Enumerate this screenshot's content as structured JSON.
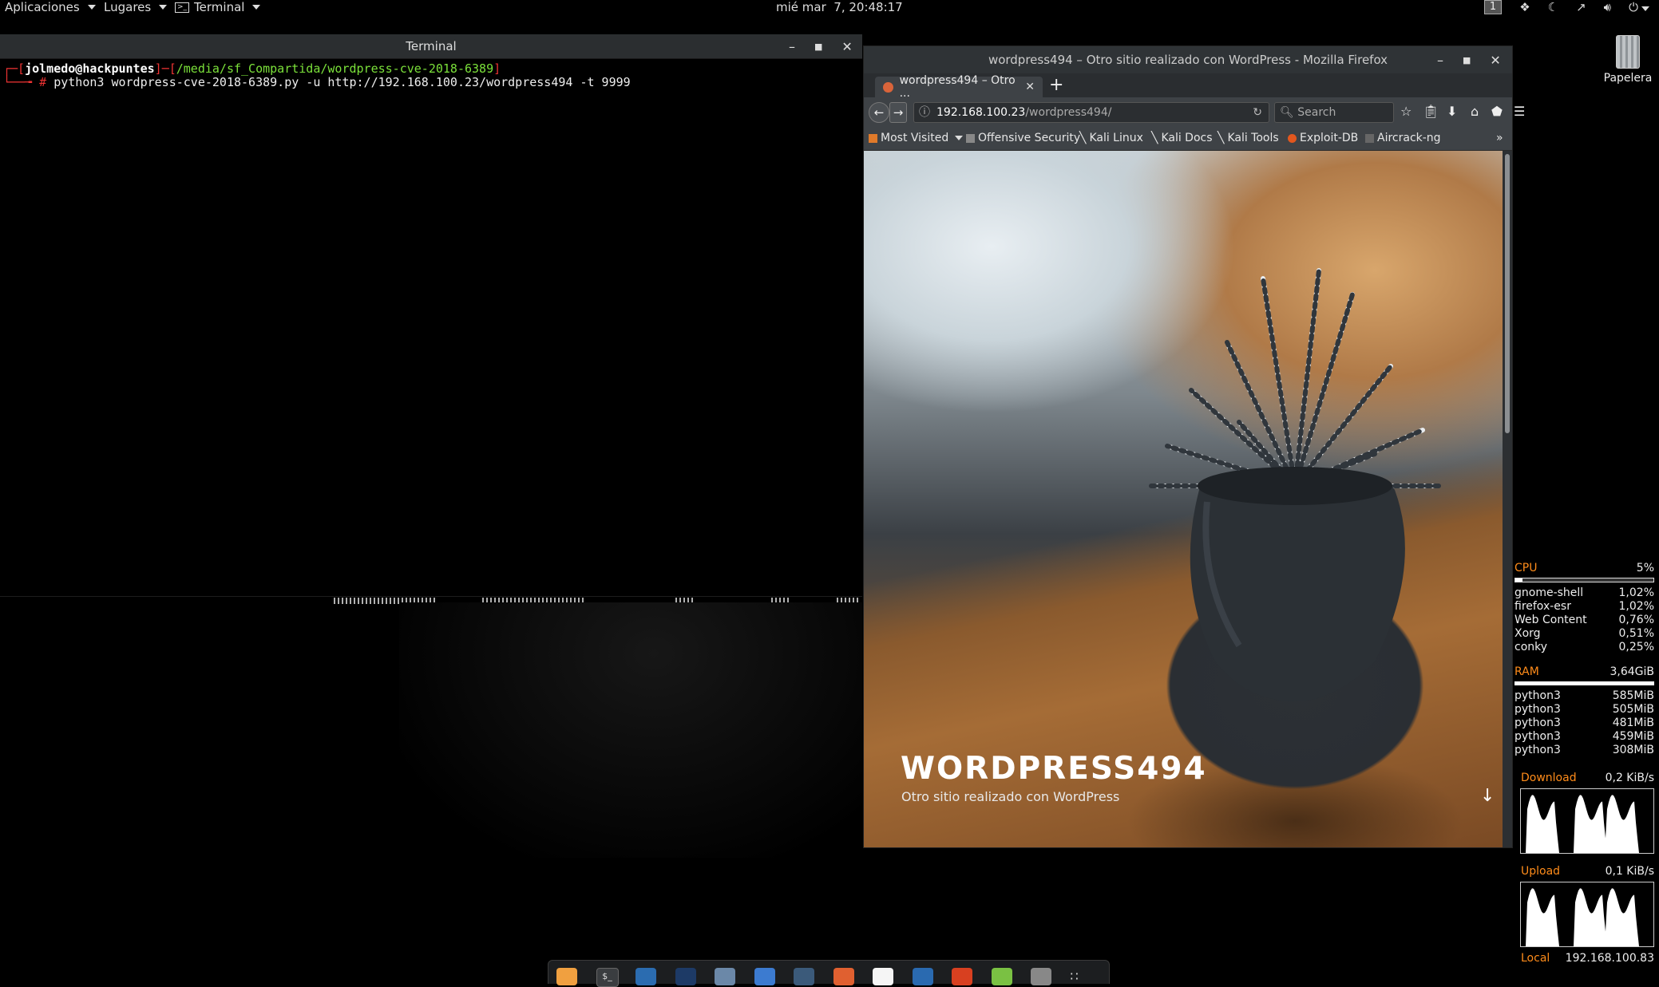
{
  "topbar": {
    "applications": "Aplicaciones",
    "places": "Lugares",
    "terminal_menu": "Terminal",
    "clock": "mié mar  7, 20:48:17",
    "workspace": "1"
  },
  "terminal": {
    "title": "Terminal",
    "prompt_open": "┌─[",
    "user_host": "jolmedo@hackpuntes",
    "prompt_mid": "]─[",
    "path": "/media/sf_Compartida/wordpress-cve-2018-6389",
    "prompt_close": "]",
    "prompt_line2": "└──╼ ",
    "hash": "#",
    "command": " python3 wordpress-cve-2018-6389.py -u http://192.168.100.23/wordpress494 -t 9999"
  },
  "firefox": {
    "window_title": "wordpress494 – Otro sitio realizado con WordPress - Mozilla Firefox",
    "tab_label": "wordpress494 – Otro ...",
    "url_host": "192.168.100.23",
    "url_path": "/wordpress494/",
    "search_placeholder": "Search",
    "bookmarks": [
      "Most Visited",
      "Offensive Security",
      "Kali Linux",
      "Kali Docs",
      "Kali Tools",
      "Exploit-DB",
      "Aircrack-ng"
    ],
    "page": {
      "site_title": "WORDPRESS494",
      "site_description": "Otro sitio realizado con WordPress"
    }
  },
  "desktop": {
    "trash_label": "Papelera"
  },
  "conky": {
    "cpu_label": "CPU",
    "cpu_value": "5%",
    "cpu_fraction": 0.05,
    "cpu_procs": [
      {
        "name": "gnome-shell",
        "value": "1,02%"
      },
      {
        "name": "firefox-esr",
        "value": "1,02%"
      },
      {
        "name": "Web Content",
        "value": "0,76%"
      },
      {
        "name": "Xorg",
        "value": "0,51%"
      },
      {
        "name": "conky",
        "value": "0,25%"
      }
    ],
    "ram_label": "RAM",
    "ram_value": "3,64GiB",
    "ram_procs": [
      {
        "name": "python3",
        "value": "585MiB"
      },
      {
        "name": "python3",
        "value": "505MiB"
      },
      {
        "name": "python3",
        "value": "481MiB"
      },
      {
        "name": "python3",
        "value": "459MiB"
      },
      {
        "name": "python3",
        "value": "308MiB"
      }
    ],
    "download_label": "Download",
    "download_value": "0,2 KiB/s",
    "upload_label": "Upload",
    "upload_value": "0,1 KiB/s",
    "local_label": "Local",
    "local_value": "192.168.100.83"
  },
  "colors": {
    "prompt_red": "#ee3333",
    "path_green": "#7be13a",
    "conky_orange": "#ff8c1a",
    "panel_bg": "#000000"
  },
  "dock_icons": [
    "vm-icon",
    "terminal-icon",
    "kali-icon",
    "browser-icon",
    "files-icon",
    "metasploit-icon",
    "armitage-icon",
    "burp-icon",
    "maltego-icon",
    "beef-icon",
    "faraday-icon",
    "notes-icon",
    "cherrytree-icon",
    "apps-grid-icon"
  ]
}
